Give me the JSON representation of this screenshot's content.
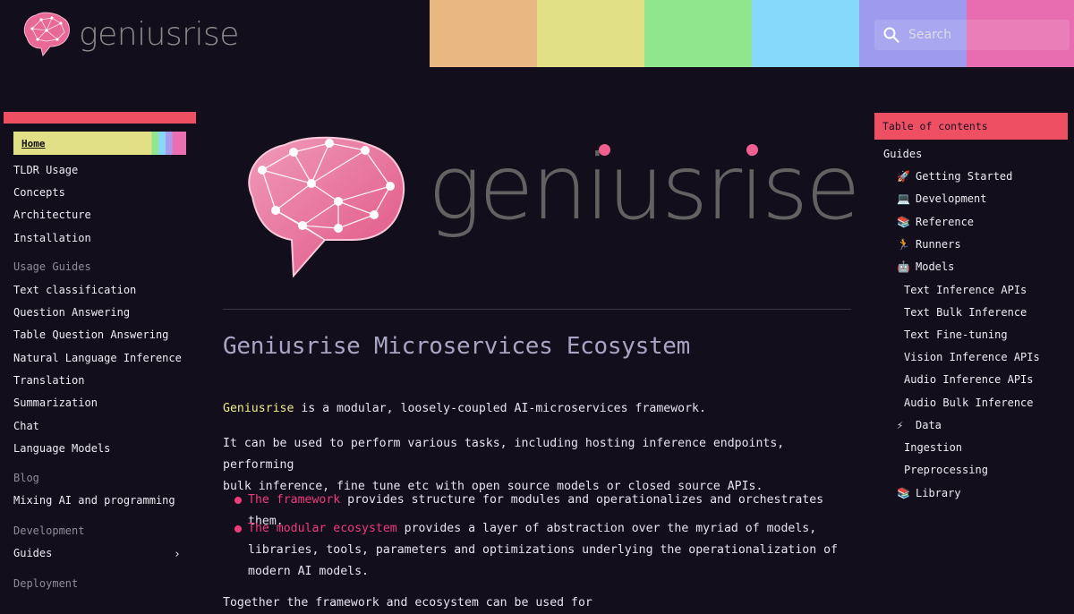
{
  "header": {
    "logo_text": "geniusrise",
    "search_placeholder": "Search",
    "stripe_colors": [
      "#e8b782",
      "#e2e086",
      "#90e68c",
      "#86d8fb",
      "#9e9bee",
      "#e86db0"
    ]
  },
  "sidebar": {
    "active": "Home",
    "items": [
      {
        "label": "TLDR Usage"
      },
      {
        "label": "Concepts"
      },
      {
        "label": "Architecture"
      },
      {
        "label": "Installation"
      }
    ],
    "sections": [
      {
        "heading": "Usage Guides",
        "items": [
          "Text classification",
          "Question Answering",
          "Table Question Answering",
          "Natural Language Inference",
          "Translation",
          "Summarization",
          "Chat",
          "Language Models"
        ]
      },
      {
        "heading": "Blog",
        "items": [
          "Mixing AI and programming"
        ]
      },
      {
        "heading": "Development",
        "items": [
          "Guides"
        ]
      },
      {
        "heading": "Deployment",
        "items": []
      }
    ]
  },
  "main": {
    "hero_text": "geniusrise",
    "title": "Geniusrise Microservices Ecosystem",
    "intro_highlight": "Geniusrise",
    "intro_rest": " is a modular, loosely-coupled AI-microservices framework.",
    "para2_line1": "It can be used to perform various tasks, including hosting inference endpoints, performing",
    "para2_line2": "bulk inference, fine tune etc with open source models or closed source APIs.",
    "bullets": [
      {
        "highlight": "The framework",
        "lines": [
          " provides structure for modules and operationalizes and orchestrates them."
        ]
      },
      {
        "highlight": "The modular ecosystem",
        "lines": [
          " provides a layer of abstraction over the myriad of models,",
          "libraries, tools, parameters and optimizations underlying the operationalization of",
          "modern AI models."
        ]
      }
    ],
    "trailing": "Together the framework and ecosystem can be used for"
  },
  "toc": {
    "title": "Table of contents",
    "guides_label": "Guides",
    "entries": [
      {
        "icon": "rocket-icon",
        "glyph": "🚀",
        "label": "Getting Started"
      },
      {
        "icon": "laptop-icon",
        "glyph": "💻",
        "label": "Development"
      },
      {
        "icon": "books-icon",
        "glyph": "📚",
        "label": "Reference"
      },
      {
        "icon": "runner-icon",
        "glyph": "🏃",
        "label": "Runners"
      },
      {
        "icon": "robot-icon",
        "glyph": "🤖",
        "label": "Models"
      }
    ],
    "models_sub": [
      "Text Inference APIs",
      "Text Bulk Inference",
      "Text Fine-tuning",
      "Vision Inference APIs",
      "Audio Inference APIs",
      "Audio Bulk Inference"
    ],
    "data_entry": {
      "icon": "lightning-icon",
      "glyph": "⚡",
      "label": "Data"
    },
    "data_sub": [
      "Ingestion",
      "Preprocessing"
    ],
    "library_entry": {
      "icon": "books-icon",
      "glyph": "📚",
      "label": "Library"
    }
  }
}
